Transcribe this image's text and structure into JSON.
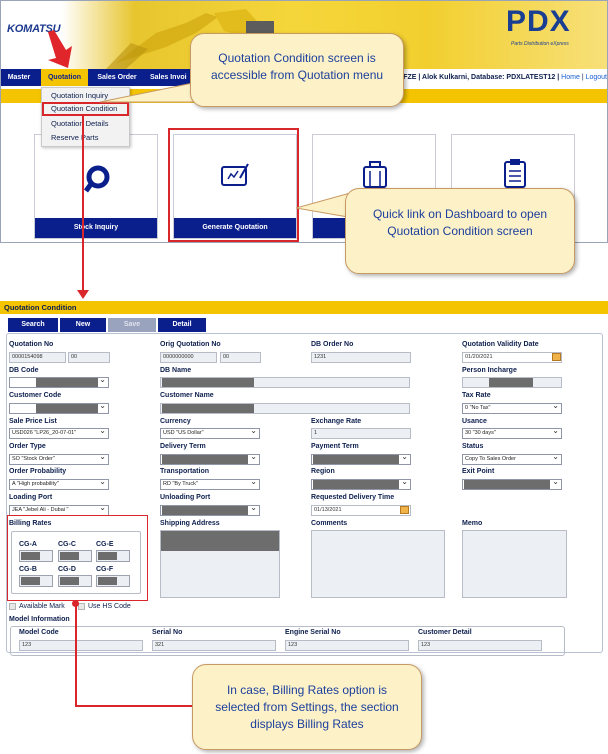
{
  "header": {
    "logo": "KOMATSU",
    "brand": "PDX",
    "brand_sub": "Parts Distribution eXpress"
  },
  "menubar": {
    "items": [
      "Master",
      "Quotation",
      "Sales Order",
      "Sales Invoi"
    ],
    "user_info": "ST FZE | Alok Kulkarni, Database: PDXLATEST12 |",
    "home": "Home",
    "logout": "Logout"
  },
  "dropdown": {
    "items": [
      "Quotation Inquiry",
      "Quotation Condition",
      "Quotation Details",
      "Reserve Parts"
    ]
  },
  "tiles": [
    "Stock Inquiry",
    "Generate Quotation",
    "",
    ""
  ],
  "callouts": {
    "menu": "Quotation Condition screen is accessible from Quotation menu",
    "dashboard": "Quick link on Dashboard to open Quotation Condition screen",
    "billing": "In case, Billing Rates option is selected from Settings, the section displays Billing Rates"
  },
  "qc": {
    "title": "Quotation Condition",
    "toolbar": [
      "Search",
      "New",
      "Save",
      "Detail"
    ],
    "fields": {
      "quotation_no_label": "Quotation No",
      "quotation_no": "0000154098",
      "quotation_no_suffix": "00",
      "orig_quotation_no_label": "Orig Quotation No",
      "orig_quotation_no": "0000000000",
      "orig_quotation_suffix": "00",
      "db_order_no_label": "DB Order No",
      "db_order_no": "1231",
      "validity_date_label": "Quotation Validity Date",
      "validity_date": "01/20/2021",
      "db_code_label": "DB Code",
      "db_name_label": "DB Name",
      "person_incharge_label": "Person Incharge",
      "customer_code_label": "Customer Code",
      "customer_name_label": "Customer Name",
      "tax_rate_label": "Tax Rate",
      "tax_rate": "0 \"No Tax\"",
      "sale_price_list_label": "Sale Price List",
      "sale_price_list": "USD026 \"LP26_20-07-01\"",
      "currency_label": "Currency",
      "currency": "USD \"US Dollar\"",
      "exchange_rate_label": "Exchange Rate",
      "exchange_rate": "1",
      "usance_label": "Usance",
      "usance": "30 \"30 days\"",
      "order_type_label": "Order Type",
      "order_type": "SO \"Stock Order\"",
      "delivery_term_label": "Delivery Term",
      "payment_term_label": "Payment Term",
      "status_label": "Status",
      "status": "Copy To Sales Order",
      "order_probability_label": "Order Probability",
      "order_probability": "A \"High probability\"",
      "transportation_label": "Transportation",
      "transportation": "RD \"By Truck\"",
      "region_label": "Region",
      "exit_point_label": "Exit Point",
      "loading_port_label": "Loading Port",
      "loading_port": "JEA \"Jebel Ali - Dubai \"",
      "unloading_port_label": "Unloading Port",
      "requested_delivery_label": "Requested Delivery Time",
      "requested_delivery": "01/13/2021",
      "billing_rates_label": "Billing Rates",
      "shipping_address_label": "Shipping Address",
      "comments_label": "Comments",
      "memo_label": "Memo",
      "available_mark_label": "Available Mark",
      "use_hs_code_label": "Use HS Code",
      "model_info_label": "Model Information",
      "model_code_label": "Model Code",
      "model_code": "123",
      "serial_no_label": "Serial No",
      "serial_no": "321",
      "engine_serial_label": "Engine Serial No",
      "engine_serial": "123",
      "customer_detail_label": "Customer Detail",
      "customer_detail": "123"
    },
    "billing_rates": [
      "CG-A",
      "CG-C",
      "CG-E",
      "CG-B",
      "CG-D",
      "CG-F"
    ]
  },
  "colors": {
    "navy": "#0b1f8c",
    "yellow": "#f5c400",
    "highlight_red": "#d9262a",
    "callout_bg": "#fdf1c8"
  }
}
